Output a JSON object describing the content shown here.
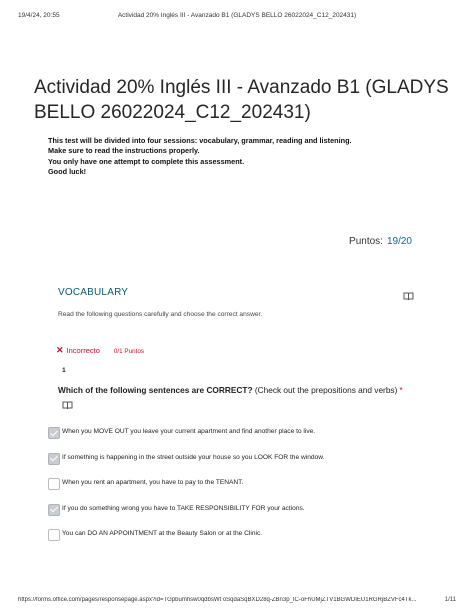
{
  "print_header": {
    "date": "19/4/24, 20:55",
    "title": "Actividad 20%  Inglés III - Avanzado B1 (GLADYS BELLO 26022024_C12_202431)"
  },
  "form": {
    "title": "Actividad 20%  Inglés III - Avanzado B1 (GLADYS BELLO 26022024_C12_202431)",
    "intro": [
      "This test will be divided into four sessions: vocabulary, grammar, reading and listening.",
      "Make sure to read the instructions properly.",
      "You only have one attempt to complete this assessment.",
      "Good luck!"
    ],
    "score_label": "Puntos:",
    "score_value": "19/20"
  },
  "section": {
    "title": "VOCABULARY",
    "description": "Read the following questions carefully and choose the correct answer.",
    "icon": "immersive-reader-icon"
  },
  "question": {
    "status_icon": "x-icon",
    "status": "Incorrecto",
    "points": "0/1 Puntos",
    "number": "1",
    "text_bold": "Which of the following sentences are CORRECT?",
    "text_rest": " (Check out the prepositions and verbs)",
    "required_mark": "*",
    "options": [
      {
        "label": "When you MOVE OUT you leave your current apartment and find another place to live.",
        "checked": true
      },
      {
        "label": "If something is happening in the street outside your house so you LOOK FOR the window.",
        "checked": true
      },
      {
        "label": "When you rent an apartment, you have to pay to the TENANT.",
        "checked": false
      },
      {
        "label": "If you do something wrong you have to TAKE RESPONSIBILITY FOR your actions.",
        "checked": true
      },
      {
        "label": "You can DO AN APPOINTMENT at the Beauty Salon or at the Clinic.",
        "checked": false
      }
    ]
  },
  "print_footer": {
    "url": "https://forms.office.com/pages/responsepage.aspx?id=TGpbumhsw0qdbsWt oSqdaSqBXD28q-ZBn3p_IC-oFhUMjZTV1BGWDIEU1RGRjBZVFc4Tk...",
    "pages": "1/11"
  }
}
